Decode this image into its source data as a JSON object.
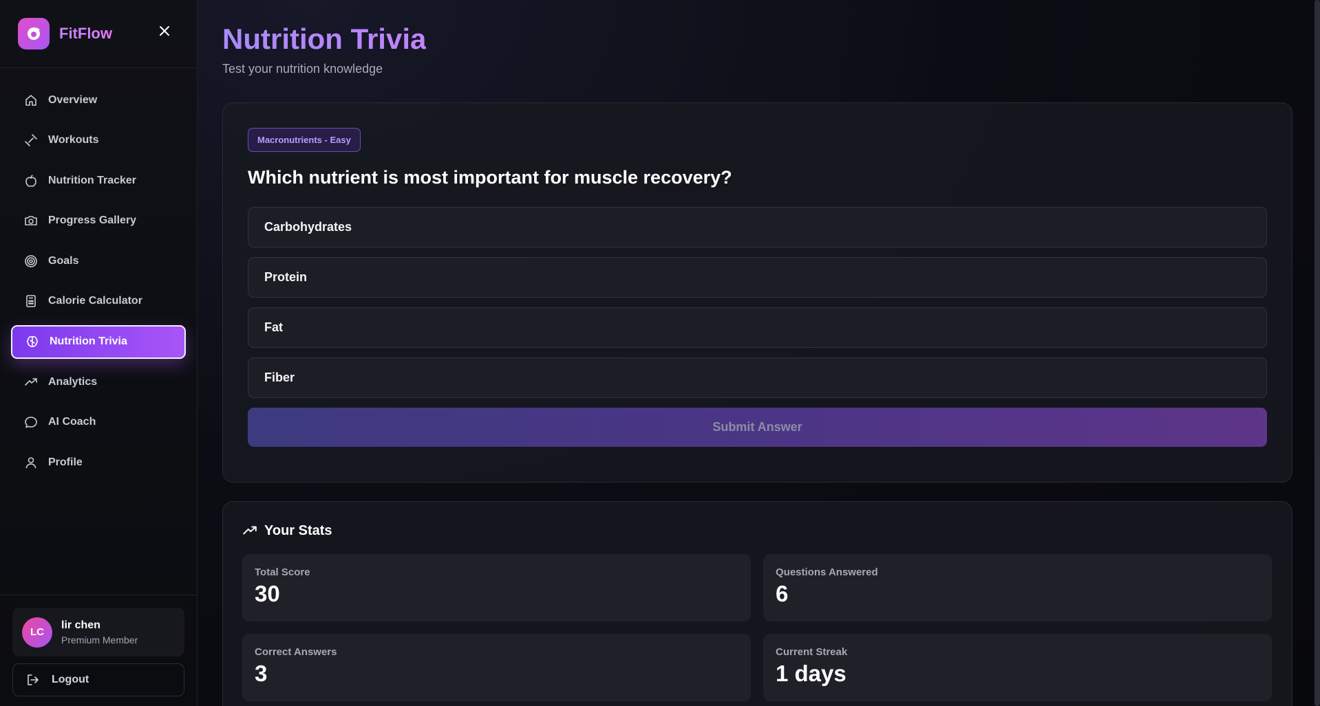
{
  "brand": {
    "name": "FitFlow"
  },
  "sidebar": {
    "items": [
      {
        "label": "Overview",
        "icon": "home-icon",
        "active": false
      },
      {
        "label": "Workouts",
        "icon": "dumbbell-icon",
        "active": false
      },
      {
        "label": "Nutrition Tracker",
        "icon": "apple-icon",
        "active": false
      },
      {
        "label": "Progress Gallery",
        "icon": "camera-icon",
        "active": false
      },
      {
        "label": "Goals",
        "icon": "target-icon",
        "active": false
      },
      {
        "label": "Calorie Calculator",
        "icon": "calculator-icon",
        "active": false
      },
      {
        "label": "Nutrition Trivia",
        "icon": "brain-icon",
        "active": true
      },
      {
        "label": "Analytics",
        "icon": "trending-up-icon",
        "active": false
      },
      {
        "label": "AI Coach",
        "icon": "chat-bubble-icon",
        "active": false
      },
      {
        "label": "Profile",
        "icon": "user-icon",
        "active": false
      }
    ]
  },
  "user": {
    "initials": "LC",
    "name": "lir chen",
    "role": "Premium Member"
  },
  "logout_label": "Logout",
  "page": {
    "title": "Nutrition Trivia",
    "subtitle": "Test your nutrition knowledge"
  },
  "quiz": {
    "badge": "Macronutrients - Easy",
    "question": "Which nutrient is most important for muscle recovery?",
    "options": [
      "Carbohydrates",
      "Protein",
      "Fat",
      "Fiber"
    ],
    "submit_label": "Submit Answer"
  },
  "stats": {
    "title": "Your Stats",
    "items": [
      {
        "label": "Total Score",
        "value": "30"
      },
      {
        "label": "Questions Answered",
        "value": "6"
      },
      {
        "label": "Correct Answers",
        "value": "3"
      },
      {
        "label": "Current Streak",
        "value": "1 days"
      }
    ]
  },
  "colors": {
    "accent": "#a855f7",
    "accent_dark": "#7c3aed",
    "brand_pink": "#e04fc7",
    "background": "#0a0b10"
  }
}
